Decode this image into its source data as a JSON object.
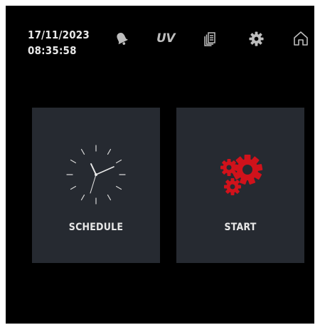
{
  "status": {
    "date": "17/11/2023",
    "time": "08:35:58"
  },
  "header": {
    "icons": [
      "bell-icon",
      "uv-icon",
      "documents-icon",
      "gear-icon",
      "home-icon"
    ],
    "uv_label": "UV"
  },
  "tiles": [
    {
      "label": "SCHEDULE",
      "icon": "clock-icon"
    },
    {
      "label": "START",
      "icon": "gears-icon"
    }
  ],
  "colors": {
    "background": "#000000",
    "tile": "#262a31",
    "text": "#e8e8e8",
    "header_icon": "#bdbdbd",
    "accent_red": "#d0121b"
  }
}
